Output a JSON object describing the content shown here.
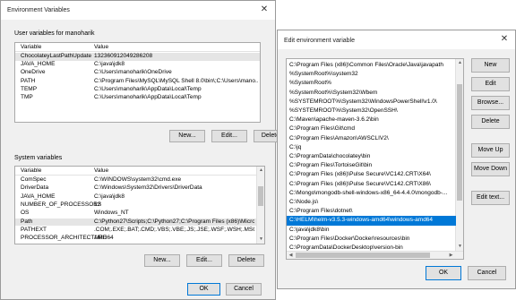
{
  "env_dialog": {
    "title": "Environment Variables",
    "close_glyph": "✕",
    "user_vars": {
      "group_label": "User variables for manoharik",
      "columns": [
        "Variable",
        "Value"
      ],
      "rows": [
        {
          "name": "ChocolateyLastPathUpdate",
          "value": "132360912049286208"
        },
        {
          "name": "JAVA_HOME",
          "value": "C:\\java\\jdk8"
        },
        {
          "name": "OneDrive",
          "value": "C:\\Users\\manoharik\\OneDrive"
        },
        {
          "name": "PATH",
          "value": "C:\\Program Files\\MySQL\\MySQL Shell 8.0\\bin\\;C:\\Users\\mano..."
        },
        {
          "name": "TEMP",
          "value": "C:\\Users\\manoharik\\AppData\\Local\\Temp"
        },
        {
          "name": "TMP",
          "value": "C:\\Users\\manoharik\\AppData\\Local\\Temp"
        }
      ],
      "buttons": {
        "new": "New...",
        "edit": "Edit...",
        "delete": "Delete"
      }
    },
    "system_vars": {
      "group_label": "System variables",
      "columns": [
        "Variable",
        "Value"
      ],
      "rows": [
        {
          "name": "ComSpec",
          "value": "C:\\WINDOWS\\system32\\cmd.exe"
        },
        {
          "name": "DriverData",
          "value": "C:\\Windows\\System32\\Drivers\\DriverData"
        },
        {
          "name": "JAVA_HOME",
          "value": "C:\\java\\jdk8"
        },
        {
          "name": "NUMBER_OF_PROCESSORS",
          "value": "12"
        },
        {
          "name": "OS",
          "value": "Windows_NT"
        },
        {
          "name": "Path",
          "value": "C:\\Python27\\Scripts;C:\\Python27;C:\\Program Files (x86)\\Micros..."
        },
        {
          "name": "PATHEXT",
          "value": ".COM;.EXE;.BAT;.CMD;.VBS;.VBE;.JS;.JSE;.WSF;.WSH;.MSC"
        },
        {
          "name": "PROCESSOR_ARCHITECTURE",
          "value": "AMD64"
        }
      ],
      "buttons": {
        "new": "New...",
        "edit": "Edit...",
        "delete": "Delete"
      }
    },
    "ok": "OK",
    "cancel": "Cancel"
  },
  "edit_dialog": {
    "title": "Edit environment variable",
    "close_glyph": "✕",
    "paths": [
      "C:\\Program Files (x86)\\Common Files\\Oracle\\Java\\javapath",
      "%SystemRoot%\\system32",
      "%SystemRoot%",
      "%SystemRoot%\\System32\\Wbem",
      "%SYSTEMROOT%\\System32\\WindowsPowerShell\\v1.0\\",
      "%SYSTEMROOT%\\System32\\OpenSSH\\",
      "C:\\Maven\\apache-maven-3.6.2\\bin",
      "C:\\Program Files\\Git\\cmd",
      "C:\\Program Files\\Amazon\\AWSCLIV2\\",
      "C:\\jq",
      "C:\\ProgramData\\chocolatey\\bin",
      "C:\\Program Files\\TortoiseGit\\bin",
      "C:\\Program Files (x86)\\Pulse Secure\\VC142.CRT\\X64\\",
      "C:\\Program Files (x86)\\Pulse Secure\\VC142.CRT\\X86\\",
      "C:\\Mongo\\mongodb-shell-windows-x86_64-4.4.0\\mongodb-...",
      "C:\\Node.js\\",
      "C:\\Program Files\\dotnet\\",
      "C:\\HELM\\helm-v3.5.3-windows-amd64\\windows-amd64",
      "C:\\java\\jdk8\\bin",
      "C:\\Program Files\\Docker\\Docker\\resources\\bin",
      "C:\\ProgramData\\DockerDesktop\\version-bin"
    ],
    "selected_index": 17,
    "buttons": {
      "new": "New",
      "edit": "Edit",
      "browse": "Browse...",
      "delete": "Delete",
      "move_up": "Move Up",
      "move_down": "Move Down",
      "edit_text": "Edit text..."
    },
    "ok": "OK",
    "cancel": "Cancel"
  },
  "icons": {
    "scroll_up": "▲",
    "scroll_down": "▼",
    "scroll_left": "◀",
    "scroll_right": "▶"
  }
}
